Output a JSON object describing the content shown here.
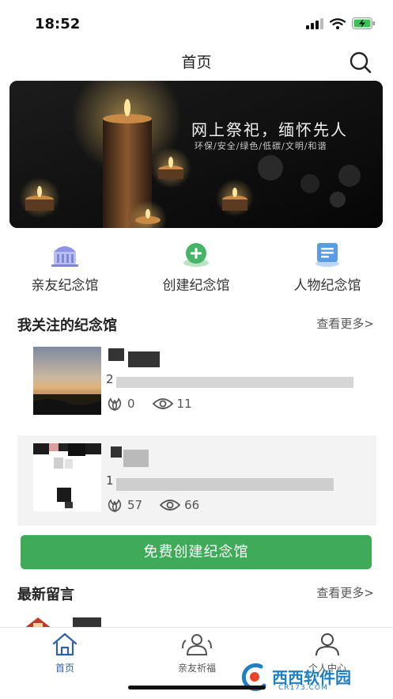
{
  "status_bar": {
    "time": "18:52"
  },
  "nav": {
    "title": "首页",
    "search_icon": "search-icon"
  },
  "banner": {
    "title": "网上祭祀，缅怀先人",
    "subtitle": "环保/安全/绿色/低碳/文明/和谐"
  },
  "quick_actions": [
    {
      "label": "亲友纪念馆",
      "icon": "memorial-hall-icon",
      "color": "#7f86d8"
    },
    {
      "label": "创建纪念馆",
      "icon": "plus-circle-icon",
      "color": "#45b467"
    },
    {
      "label": "人物纪念馆",
      "icon": "document-icon",
      "color": "#4a8ee0"
    }
  ],
  "followed": {
    "title": "我关注的纪念馆",
    "more": "查看更多>",
    "items": [
      {
        "name_prefix": "",
        "date_prefix": "2",
        "flowers": "0",
        "views": "11"
      },
      {
        "name_prefix": "",
        "date_prefix": "1",
        "flowers": "57",
        "views": "66"
      }
    ]
  },
  "create_button": "免费创建纪念馆",
  "messages": {
    "title": "最新留言",
    "more": "查看更多>"
  },
  "tabbar": {
    "items": [
      {
        "label": "首页",
        "icon": "home-icon",
        "active": true
      },
      {
        "label": "亲友祈福",
        "icon": "people-icon",
        "active": false
      },
      {
        "label": "个人中心",
        "icon": "user-icon",
        "active": false
      }
    ]
  },
  "colors": {
    "accent": "#3faa57",
    "tab_active": "#2f5fa8",
    "tab_inactive": "#555555"
  },
  "watermark": {
    "text": "西西软件园",
    "domain": "CR173.COM"
  }
}
